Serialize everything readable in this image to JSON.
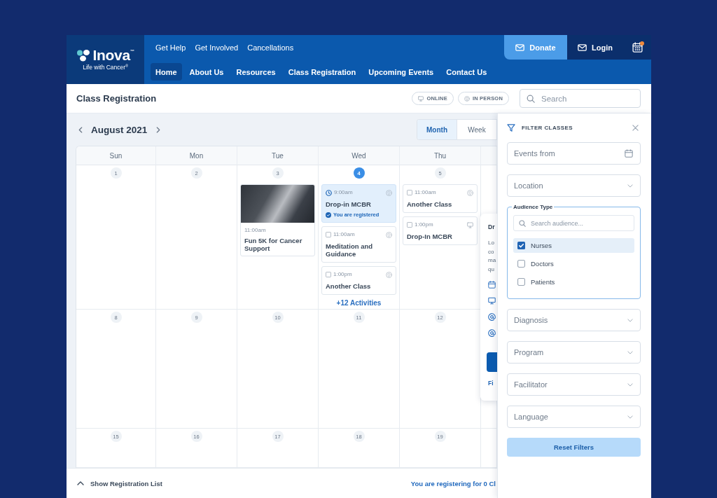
{
  "header": {
    "logo": {
      "name": "Inova$^{™}$",
      "tagline": "Life with Cancer$^{®}$"
    },
    "utility_links": [
      "Get Help",
      "Get Involved",
      "Cancellations"
    ],
    "donate": "Donate",
    "login": "Login",
    "calendar_notification": true,
    "nav": [
      {
        "label": "Home",
        "selected": true
      },
      {
        "label": "About Us",
        "selected": false
      },
      {
        "label": "Resources",
        "selected": false
      },
      {
        "label": "Class Registration",
        "selected": false
      },
      {
        "label": "Upcoming Events",
        "selected": false
      },
      {
        "label": "Contact Us",
        "selected": false
      }
    ]
  },
  "title_bar": {
    "title": "Class Registration",
    "mode_filters": [
      {
        "label": "ONLINE",
        "kind": "online"
      },
      {
        "label": "IN PERSON",
        "kind": "in_person"
      }
    ],
    "search": {
      "placeholder": "Search"
    }
  },
  "calendar": {
    "month": "August 2021",
    "views": [
      {
        "label": "Month",
        "selected": true
      },
      {
        "label": "Week",
        "selected": false
      }
    ],
    "weekdays": [
      "Sun",
      "Mon",
      "Tue",
      "Wed",
      "Thu"
    ],
    "weeks": [
      {
        "days": [
          {
            "number": "1",
            "today": false
          },
          {
            "number": "2",
            "today": false
          },
          {
            "number": "3",
            "today": false,
            "events": [
              {
                "kind": "photo",
                "time": "11:00am",
                "title": "Fun 5K for Cancer Support"
              }
            ]
          },
          {
            "number": "4",
            "today": true,
            "events": [
              {
                "kind": "in_person",
                "time": "9:00am",
                "title": "Drop-in MCBR",
                "registered": true,
                "status": "You are registered"
              },
              {
                "kind": "in_person",
                "time": "11:00am",
                "title": "Meditation and Guidance",
                "registered": false,
                "checked": false
              },
              {
                "kind": "in_person",
                "time": "1:00pm",
                "title": "Another Class",
                "registered": false,
                "checked": false
              }
            ],
            "more": "+12 Activities"
          },
          {
            "number": "5",
            "today": false,
            "events": [
              {
                "kind": "in_person",
                "time": "11:00am",
                "title": "Another Class",
                "registered": false,
                "checked": false
              },
              {
                "kind": "online",
                "time": "1:00pm",
                "title": "Drop-In MCBR",
                "registered": false,
                "checked": false
              }
            ]
          }
        ]
      },
      {
        "days": [
          {
            "number": "8",
            "today": false
          },
          {
            "number": "9",
            "today": false
          },
          {
            "number": "10",
            "today": false
          },
          {
            "number": "11",
            "today": false
          },
          {
            "number": "12",
            "today": false
          }
        ]
      },
      {
        "days": [
          {
            "number": "15",
            "today": false
          },
          {
            "number": "16",
            "today": false
          },
          {
            "number": "17",
            "today": false
          },
          {
            "number": "18",
            "today": false
          },
          {
            "number": "19",
            "today": false
          }
        ]
      }
    ]
  },
  "popover": {
    "title": "Dr",
    "lines": [
      "Lo",
      "co",
      "ma",
      "qu"
    ],
    "link": "Fi"
  },
  "bottom_bar": {
    "toggle": "Show Registration List",
    "summary": "You are registering for 0 Cl"
  },
  "filter_panel": {
    "title": "FILTER CLASSES",
    "fields": [
      {
        "kind": "date",
        "placeholder": "Events from"
      },
      {
        "kind": "select",
        "placeholder": "Location"
      },
      {
        "kind": "checklist",
        "legend": "Audience Type",
        "search": {
          "placeholder": "Search audience..."
        },
        "options": [
          {
            "label": "Nurses",
            "checked": true,
            "selected": true
          },
          {
            "label": "Doctors",
            "checked": false,
            "selected": false
          },
          {
            "label": "Patients",
            "checked": false,
            "selected": false
          }
        ]
      },
      {
        "kind": "select",
        "placeholder": "Diagnosis"
      },
      {
        "kind": "select",
        "placeholder": "Program"
      },
      {
        "kind": "select",
        "placeholder": "Facilitator"
      },
      {
        "kind": "select",
        "placeholder": "Language"
      }
    ],
    "reset_button": "Reset Filters"
  }
}
